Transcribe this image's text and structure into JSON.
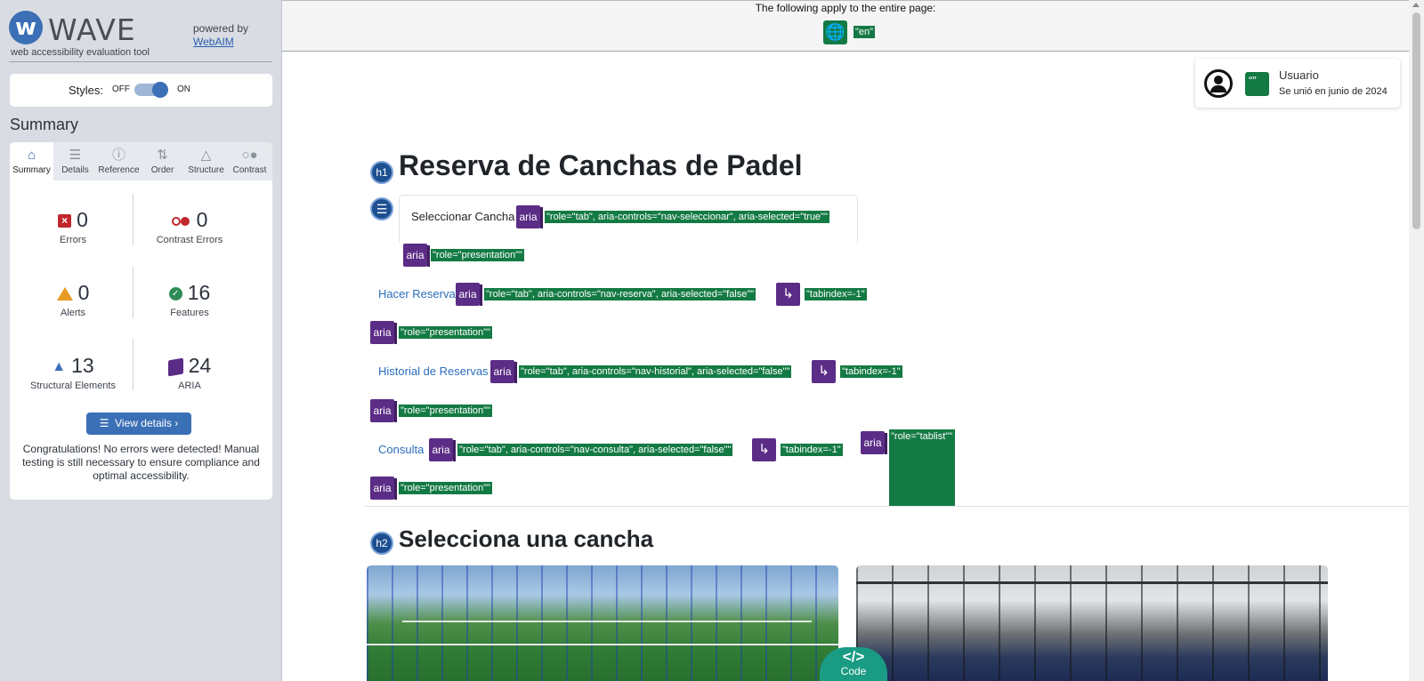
{
  "wave": {
    "logo_text": "WAVE",
    "logo_subtitle": "web accessibility evaluation tool",
    "powered_by": "powered by",
    "webaim_link": "WebAIM",
    "styles_label": "Styles:",
    "styles_off": "OFF",
    "styles_on": "ON",
    "styles_enabled": true,
    "summary_title": "Summary",
    "tabs": [
      {
        "label": "Summary",
        "icon": "home-icon",
        "active": true
      },
      {
        "label": "Details",
        "icon": "list-icon",
        "active": false
      },
      {
        "label": "Reference",
        "icon": "info-icon",
        "active": false
      },
      {
        "label": "Order",
        "icon": "order-icon",
        "active": false
      },
      {
        "label": "Structure",
        "icon": "structure-icon",
        "active": false
      },
      {
        "label": "Contrast",
        "icon": "contrast-toggle-icon",
        "active": false
      }
    ],
    "stats": {
      "errors": {
        "value": "0",
        "label": "Errors"
      },
      "contrast_errors": {
        "value": "0",
        "label": "Contrast Errors"
      },
      "alerts": {
        "value": "0",
        "label": "Alerts"
      },
      "features": {
        "value": "16",
        "label": "Features"
      },
      "structural": {
        "value": "13",
        "label": "Structural Elements"
      },
      "aria": {
        "value": "24",
        "label": "ARIA"
      }
    },
    "view_details": "View details ›",
    "congrats": "Congratulations! No errors were detected! Manual testing is still necessary to ensure compliance and optimal accessibility.",
    "colors": {
      "accent": "#3b6fb6",
      "error": "#c1272d",
      "alert": "#e89b23",
      "feature": "#2e8b57",
      "aria": "#5b2d86",
      "tag_green": "#147a44"
    }
  },
  "page": {
    "apply_text": "The following apply to the entire page:",
    "lang_tag": "\"en\"",
    "user": {
      "name": "Usuario",
      "joined": "Se unió en junio de 2024"
    },
    "h1_badge": "h1",
    "h1": "Reserva de Canchas de Padel",
    "nav": {
      "tab1": "Seleccionar Cancha",
      "tab1_aria": "\"role=\"tab\", aria-controls=\"nav-seleccionar\", aria-selected=\"true\"\"",
      "presentation": "\"role=\"presentation\"\"",
      "tab2": "Hacer Reserva",
      "tab2_aria": "\"role=\"tab\", aria-controls=\"nav-reserva\", aria-selected=\"false\"\"",
      "tab3": "Historial de Reservas",
      "tab3_aria": "\"role=\"tab\", aria-controls=\"nav-historial\", aria-selected=\"false\"\"",
      "tab4": "Consulta",
      "tab4_aria": "\"role=\"tab\", aria-controls=\"nav-consulta\", aria-selected=\"false\"\"",
      "tabindex": "\"tabindex=-1\"",
      "tablist": "\"role=\"tablist\"\"",
      "aria_label": "aria"
    },
    "h2_badge": "h2",
    "h2": "Selecciona una cancha",
    "code_button": "Code",
    "code_glyph": "</>"
  }
}
